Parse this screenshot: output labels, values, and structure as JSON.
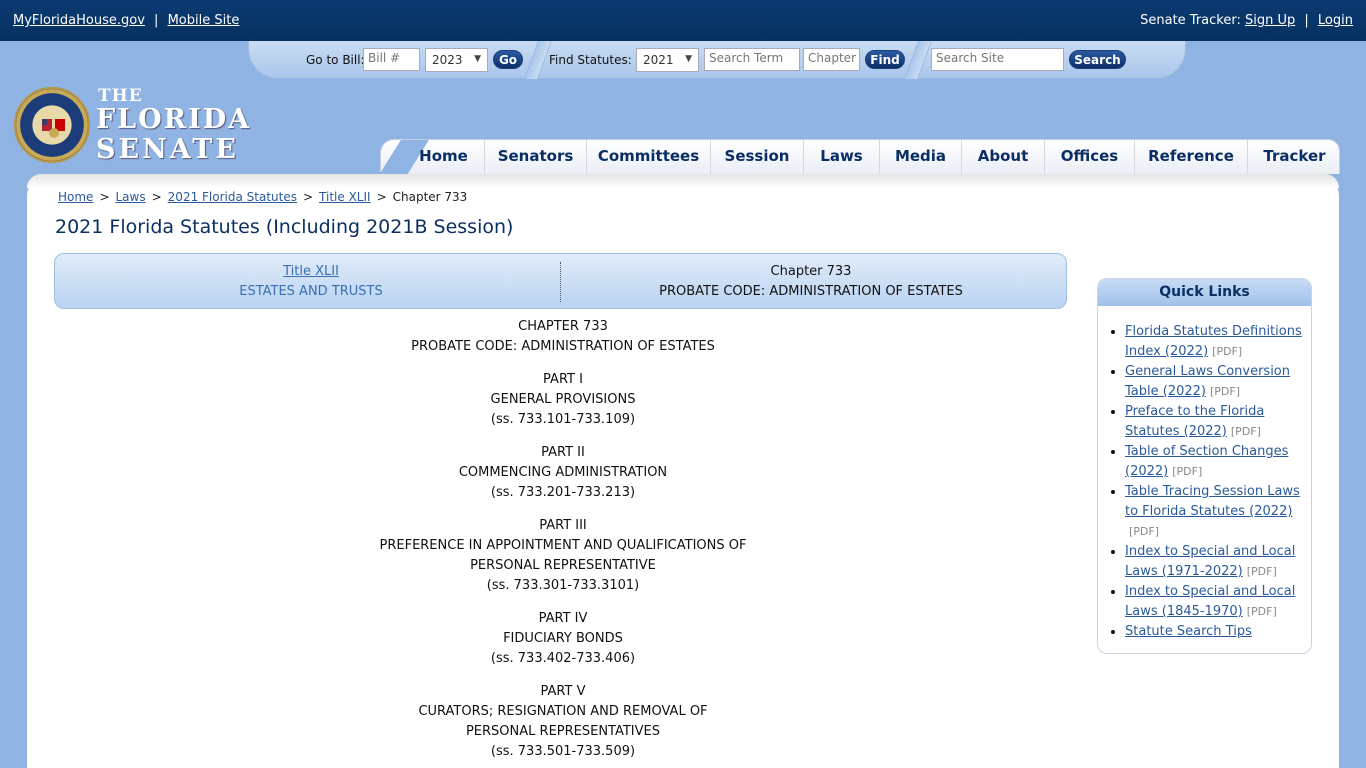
{
  "topbar": {
    "site_link": "MyFloridaHouse.gov",
    "sep": "|",
    "mobile_link": "Mobile Site",
    "tracker_label": "Senate Tracker:",
    "signup": "Sign Up",
    "login": "Login"
  },
  "search": {
    "goto_bill_label": "Go to Bill:",
    "bill_placeholder": "Bill #",
    "bill_year": "2023",
    "go": "Go",
    "find_statutes_label": "Find Statutes:",
    "statute_year": "2021",
    "term_placeholder": "Search Term",
    "chapter_placeholder": "Chapter",
    "find": "Find",
    "site_placeholder": "Search Site",
    "search": "Search"
  },
  "logo": {
    "the": "THE",
    "florida": "FLORIDA",
    "senate": "SENATE"
  },
  "nav": [
    "Home",
    "Senators",
    "Committees",
    "Session",
    "Laws",
    "Media",
    "About",
    "Offices",
    "Reference",
    "Tracker"
  ],
  "breadcrumb": {
    "home": "Home",
    "laws": "Laws",
    "statutes": "2021 Florida Statutes",
    "title": "Title XLII",
    "current": "Chapter 733",
    "sep": ">"
  },
  "page_title": "2021 Florida Statutes (Including 2021B Session)",
  "titlebar": {
    "title_link": "Title XLII",
    "title_sub": "ESTATES AND TRUSTS",
    "chapter": "Chapter 733",
    "chapter_sub": "PROBATE CODE: ADMINISTRATION OF ESTATES"
  },
  "chapter": {
    "heading": "CHAPTER 733",
    "name": "PROBATE CODE: ADMINISTRATION OF ESTATES",
    "parts": [
      {
        "part": "PART I",
        "title": "GENERAL PROVISIONS",
        "range": "(ss. 733.101-733.109)"
      },
      {
        "part": "PART II",
        "title": "COMMENCING ADMINISTRATION",
        "range": "(ss. 733.201-733.213)"
      },
      {
        "part": "PART III",
        "title": "PREFERENCE IN APPOINTMENT AND QUALIFICATIONS OF PERSONAL REPRESENTATIVE",
        "range": "(ss. 733.301-733.3101)"
      },
      {
        "part": "PART IV",
        "title": "FIDUCIARY BONDS",
        "range": "(ss. 733.402-733.406)"
      },
      {
        "part": "PART V",
        "title": "CURATORS; RESIGNATION AND REMOVAL OF PERSONAL REPRESENTATIVES",
        "range": "(ss. 733.501-733.509)"
      }
    ]
  },
  "quick_links": {
    "heading": "Quick Links",
    "items": [
      {
        "text": "Florida Statutes Definitions Index (2022)",
        "tag": "[PDF]"
      },
      {
        "text": "General Laws Conversion Table (2022)",
        "tag": "[PDF]"
      },
      {
        "text": "Preface to the Florida Statutes (2022)",
        "tag": "[PDF]"
      },
      {
        "text": "Table of Section Changes (2022)",
        "tag": "[PDF]"
      },
      {
        "text": "Table Tracing Session Laws to Florida Statutes (2022)",
        "tag": "[PDF]"
      },
      {
        "text": "Index to Special and Local Laws (1971-2022)",
        "tag": "[PDF]"
      },
      {
        "text": "Index to Special and Local Laws (1845-1970)",
        "tag": "[PDF]"
      },
      {
        "text": "Statute Search Tips",
        "tag": ""
      }
    ]
  },
  "colors": {
    "header_bg": "#06305f",
    "page_bg": "#8fb3e2",
    "link": "#2a5a9a",
    "nav_text": "#0a2e63"
  }
}
